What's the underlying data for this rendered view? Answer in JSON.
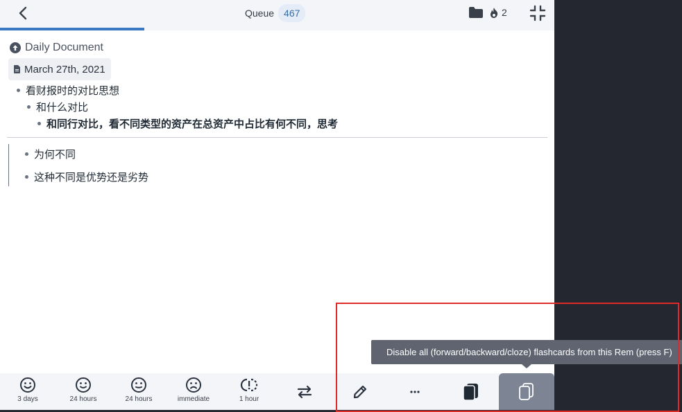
{
  "topbar": {
    "queue_label": "Queue",
    "queue_count": "467",
    "streak_count": "2",
    "progress_fraction": 0.26,
    "back_icon": "chevron-left-icon",
    "folder_icon": "folder-icon",
    "streak_icon": "fire-icon",
    "collapse_icon": "collapse-icon"
  },
  "breadcrumb": {
    "parent": "Daily Document",
    "doc": "March 27th, 2021"
  },
  "question": {
    "lines": [
      "看财报时的对比思想",
      "和什么对比",
      "和同行对比，看不同类型的资产在总资产中占比有何不同，思考"
    ]
  },
  "answer": {
    "lines": [
      "为何不同",
      "这种不同是优势还是劣势"
    ]
  },
  "ratings": [
    {
      "label": "3 days",
      "icon": "smile-icon"
    },
    {
      "label": "24 hours",
      "icon": "smile-icon"
    },
    {
      "label": "24 hours",
      "icon": "neutral-face-icon"
    },
    {
      "label": "immediate",
      "icon": "sad-face-icon"
    },
    {
      "label": "1 hour",
      "icon": "skip-icon"
    }
  ],
  "tooltip": {
    "text": "Disable all (forward/backward/cloze) flashcards from this Rem (press F)"
  },
  "colors": {
    "accent": "#3b78c4",
    "highlight": "#e02a2a",
    "active_button": "#7d8595"
  }
}
